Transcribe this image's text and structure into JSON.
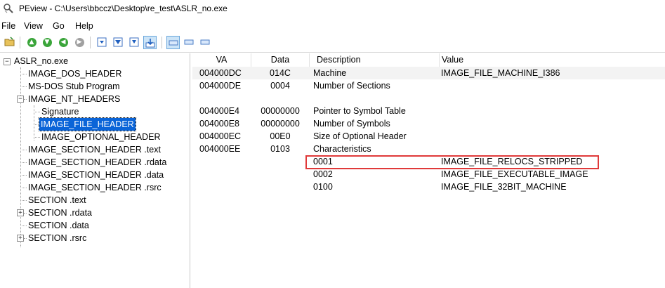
{
  "window": {
    "title": "PEview - C:\\Users\\bbccz\\Desktop\\re_test\\ASLR_no.exe",
    "app_icon": "magnifier-icon"
  },
  "menu": {
    "items": [
      "File",
      "View",
      "Go",
      "Help"
    ]
  },
  "toolbar": {
    "buttons": [
      "open-folder-icon",
      "up-arrow-icon",
      "down-arrow-icon",
      "back-arrow-icon",
      "forward-arrow-icon",
      "view-byte-icon",
      "view-word-icon",
      "view-dword-icon",
      "view-details-icon",
      "layout-a-icon",
      "layout-b-icon",
      "layout-c-icon"
    ]
  },
  "tree": {
    "root": "ASLR_no.exe",
    "nodes": [
      "IMAGE_DOS_HEADER",
      "MS-DOS Stub Program",
      "IMAGE_NT_HEADERS",
      "Signature",
      "IMAGE_FILE_HEADER",
      "IMAGE_OPTIONAL_HEADER",
      "IMAGE_SECTION_HEADER .text",
      "IMAGE_SECTION_HEADER .rdata",
      "IMAGE_SECTION_HEADER .data",
      "IMAGE_SECTION_HEADER .rsrc",
      "SECTION .text",
      "SECTION .rdata",
      "SECTION .data",
      "SECTION .rsrc"
    ],
    "selected": "IMAGE_FILE_HEADER",
    "expander_collapsed": "+",
    "expander_expanded": "−"
  },
  "list": {
    "columns": [
      "VA",
      "Data",
      "Description",
      "Value"
    ],
    "rows": [
      {
        "va": "004000DC",
        "data": "014C",
        "desc": "Machine",
        "value": "IMAGE_FILE_MACHINE_I386"
      },
      {
        "va": "004000DE",
        "data": "0004",
        "desc": "Number of Sections",
        "value": ""
      },
      {
        "va": "",
        "data": "",
        "desc": "",
        "value": ""
      },
      {
        "va": "004000E4",
        "data": "00000000",
        "desc": "Pointer to Symbol Table",
        "value": ""
      },
      {
        "va": "004000E8",
        "data": "00000000",
        "desc": "Number of Symbols",
        "value": ""
      },
      {
        "va": "004000EC",
        "data": "00E0",
        "desc": "Size of Optional Header",
        "value": ""
      },
      {
        "va": "004000EE",
        "data": "0103",
        "desc": "Characteristics",
        "value": ""
      },
      {
        "va": "",
        "data": "",
        "desc": "0001",
        "value": "IMAGE_FILE_RELOCS_STRIPPED"
      },
      {
        "va": "",
        "data": "",
        "desc": "0002",
        "value": "IMAGE_FILE_EXECUTABLE_IMAGE"
      },
      {
        "va": "",
        "data": "",
        "desc": "0100",
        "value": "IMAGE_FILE_32BIT_MACHINE"
      }
    ],
    "highlighted_value": "IMAGE_FILE_RELOCS_STRIPPED",
    "highlight_color": "#e03a3a"
  },
  "colors": {
    "selection": "#0a64d8",
    "alt_row": "#f3f3f3"
  }
}
